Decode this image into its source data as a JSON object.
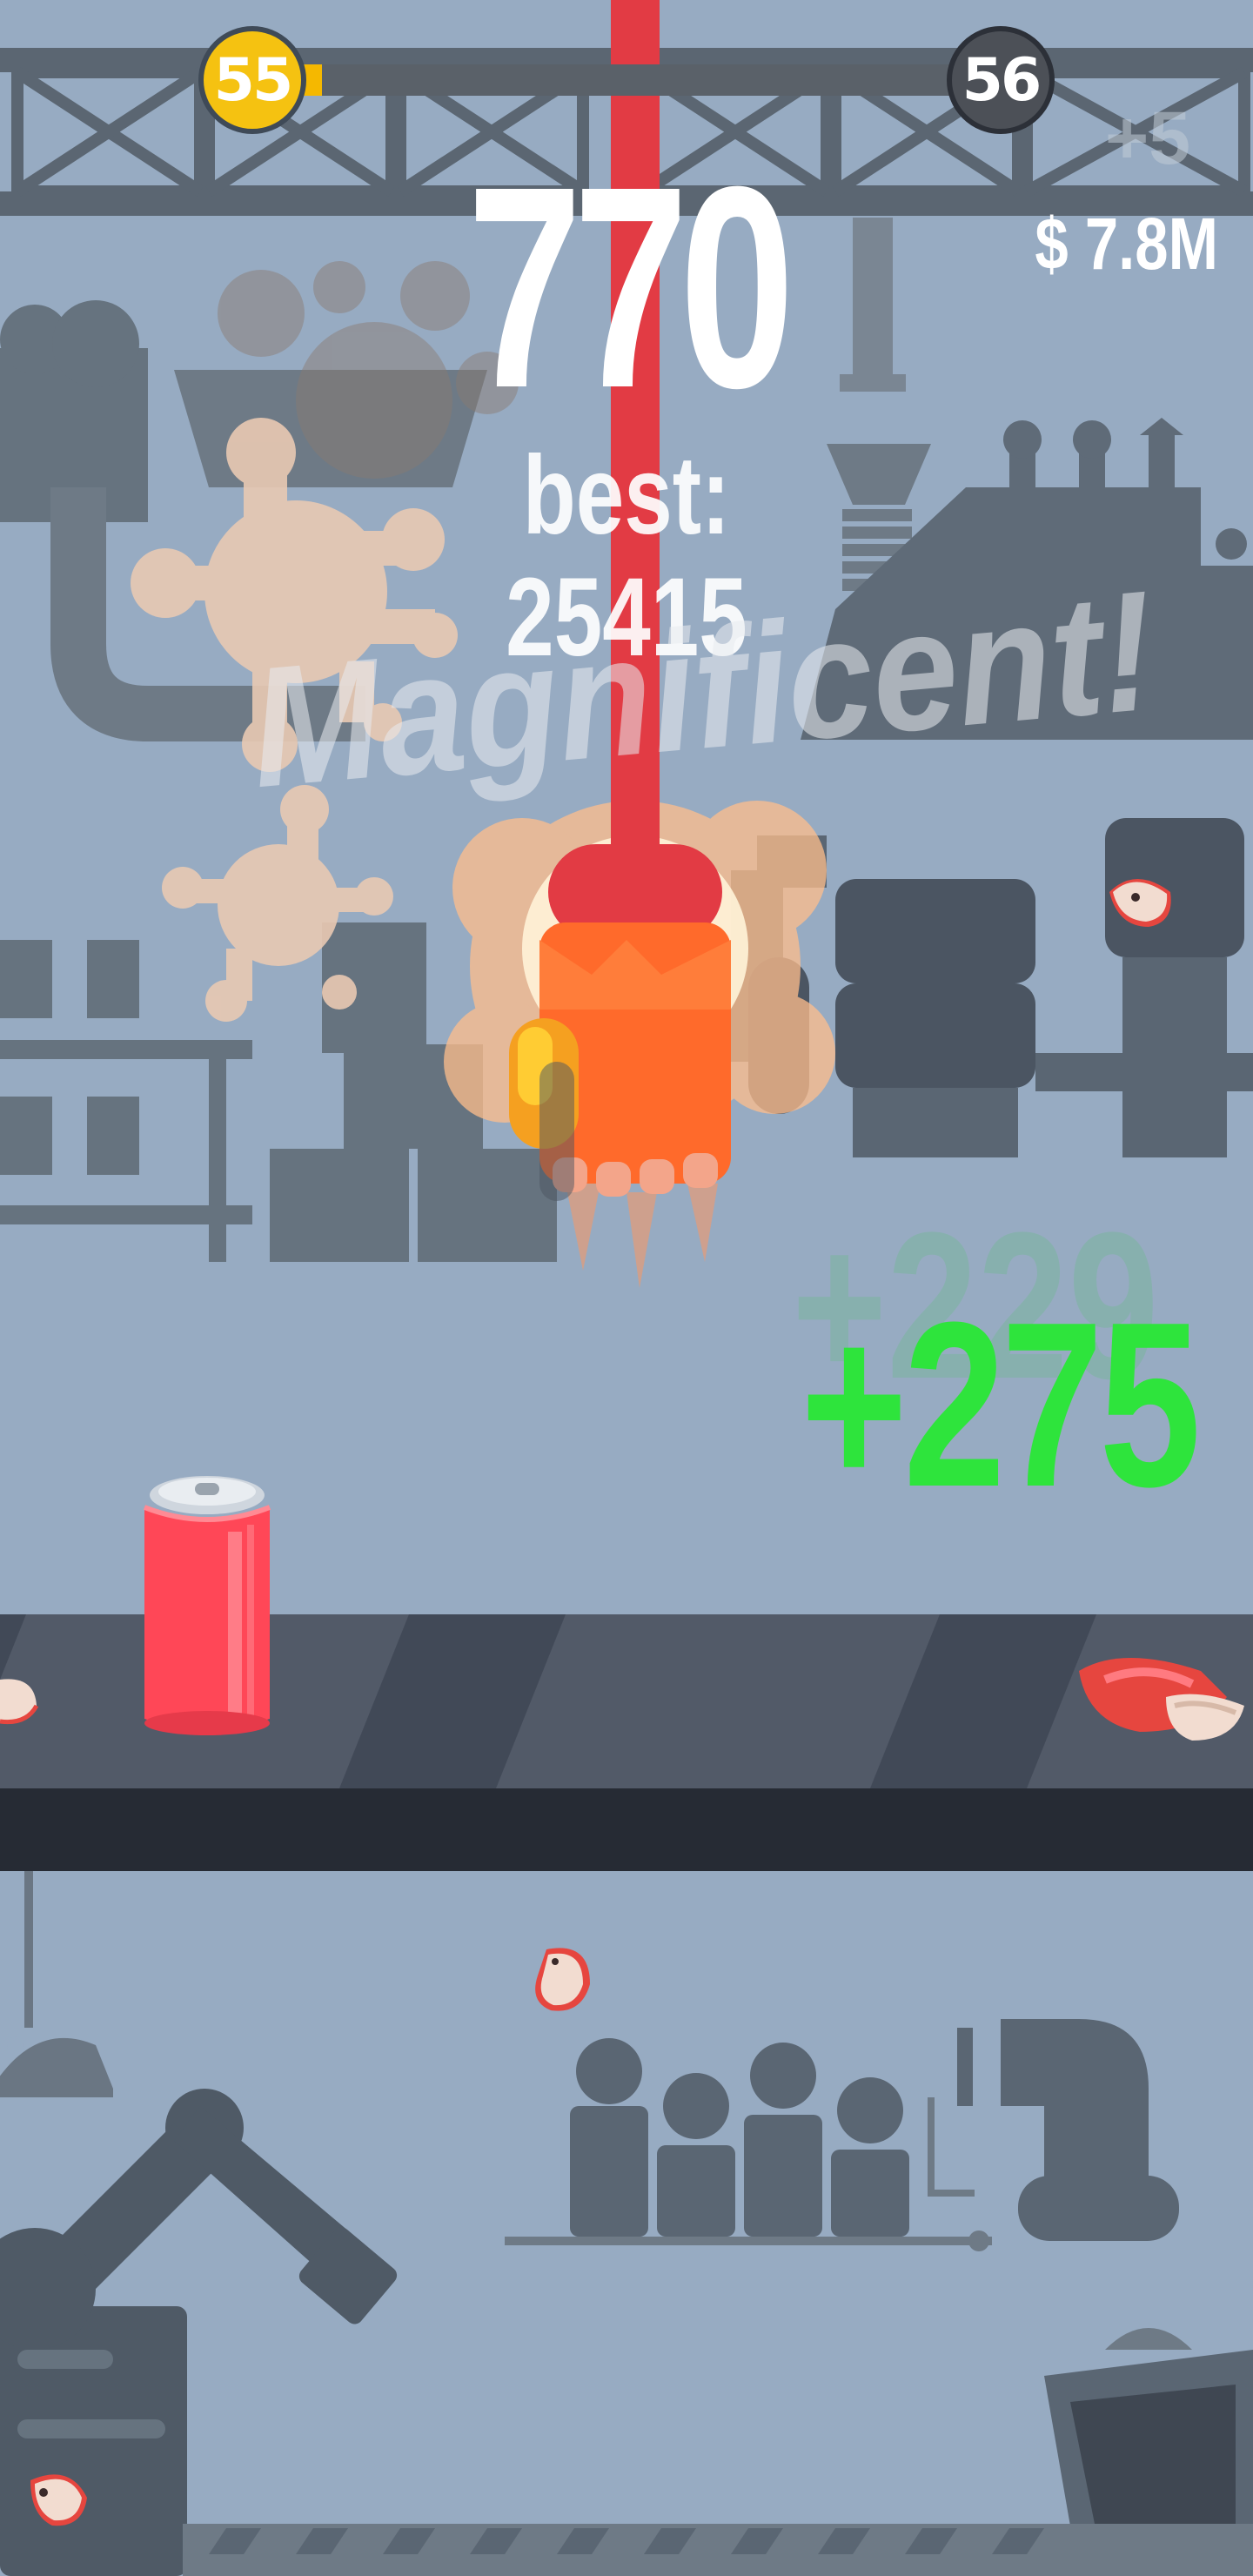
{
  "level": {
    "current": "55",
    "next": "56",
    "progress": 0.04
  },
  "score": "770",
  "best_label": "best: 25415",
  "money": "$ 7.8M",
  "ghost_bonus": "+5",
  "praise": "Magnificent!",
  "ghost_gain": "+229",
  "gain": "+275",
  "colors": {
    "background": "#97abc2",
    "level_badge": "#f5c211",
    "next_badge": "#4c5057",
    "gain_text": "#2ee43c",
    "rope": "#e23b44",
    "fist": "#ff6a2b",
    "can": "#ff4757",
    "conveyor": "#414957"
  },
  "icons": [
    "rope",
    "fire-fist",
    "soda-can",
    "splat",
    "debris"
  ]
}
